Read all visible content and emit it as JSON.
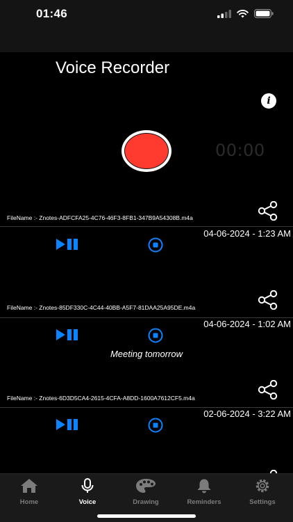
{
  "status": {
    "time": "01:46"
  },
  "app": {
    "title": "Voice Recorder"
  },
  "recorder": {
    "timer": "00:00"
  },
  "recordings": [
    {
      "filename": "FileName :- Znotes-ADFCFA25-4C76-46F3-8FB1-347B9A54308B.m4a",
      "date": "04-06-2024 - 1:23 AM",
      "note": ""
    },
    {
      "filename": "FileName :- Znotes-85DF330C-4C44-40BB-A5F7-81DAA25A95DE.m4a",
      "date": "04-06-2024 - 1:02 AM",
      "note": "Meeting tomorrow"
    },
    {
      "filename": "FileName :- Znotes-6D3D5CA4-2615-4CFA-A8DD-1600A7612CF5.m4a",
      "date": "02-06-2024 - 3:22 AM",
      "note": ""
    }
  ],
  "tabs": [
    {
      "label": "Home",
      "icon": "home-icon"
    },
    {
      "label": "Voice",
      "icon": "microphone-icon"
    },
    {
      "label": "Drawing",
      "icon": "palette-icon"
    },
    {
      "label": "Reminders",
      "icon": "bell-icon"
    },
    {
      "label": "Settings",
      "icon": "gear-icon"
    }
  ],
  "colors": {
    "accent": "#0a84ff",
    "record": "#ff3b30",
    "tab_inactive": "#7c7c7c"
  }
}
